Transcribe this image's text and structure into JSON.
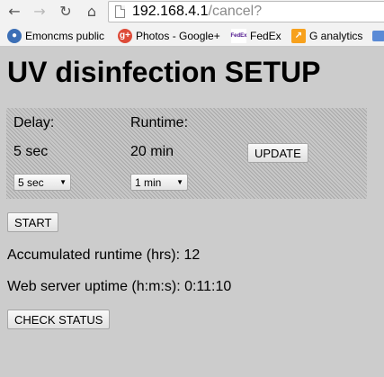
{
  "browser": {
    "url_host": "192.168.4.1",
    "url_path": "/cancel?",
    "bookmarks": [
      {
        "label": "Emoncms public",
        "icon": "emoncms-icon"
      },
      {
        "label": "Photos - Google+",
        "icon": "google-plus-icon"
      },
      {
        "label": "FedEx",
        "icon": "fedex-icon"
      },
      {
        "label": "G analytics",
        "icon": "analytics-icon"
      }
    ]
  },
  "page": {
    "title": "UV disinfection SETUP",
    "delay": {
      "label": "Delay:",
      "current": "5 sec",
      "selected_option": "5 sec"
    },
    "runtime": {
      "label": "Runtime:",
      "current": "20 min",
      "selected_option": "1 min"
    },
    "update_button": "UPDATE",
    "start_button": "START",
    "accumulated_runtime": "Accumulated runtime (hrs): 12",
    "uptime": "Web server uptime (h:m:s): 0:11:10",
    "check_status_button": "CHECK STATUS"
  },
  "colors": {
    "page_background": "#cccccc",
    "panel_background": "#b8b8b8"
  }
}
